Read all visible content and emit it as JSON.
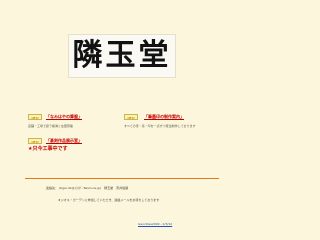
{
  "logo": {
    "text": "隣玉堂"
  },
  "sections": {
    "left_top": {
      "badge": "NEW",
      "title": "「なみはやの算盤」",
      "desc": "店舗・工場で扱う帳簿と在庫算盤"
    },
    "right_top": {
      "badge": "NEW",
      "title": "「筆墨印の制作案内」",
      "desc": "すべての筆・墨・印を一点ずつ受注制作しております"
    },
    "left_bottom": {
      "badge": "NEW",
      "title": "「篆刻作品展示室」",
      "notice": "★只今工事中です"
    }
  },
  "contact": {
    "text": "連絡先： (tiger-dk@ﾄﾗｲﾀﾞ-Taisin.ne.jp)　隣玉堂　奈井俗緒"
  },
  "note": {
    "text": "★ジオキ・ガーデンに参加していただき、連絡メールをお待ちしております"
  },
  "footer": {
    "text": "Geocities2000 - 2/3/12"
  }
}
